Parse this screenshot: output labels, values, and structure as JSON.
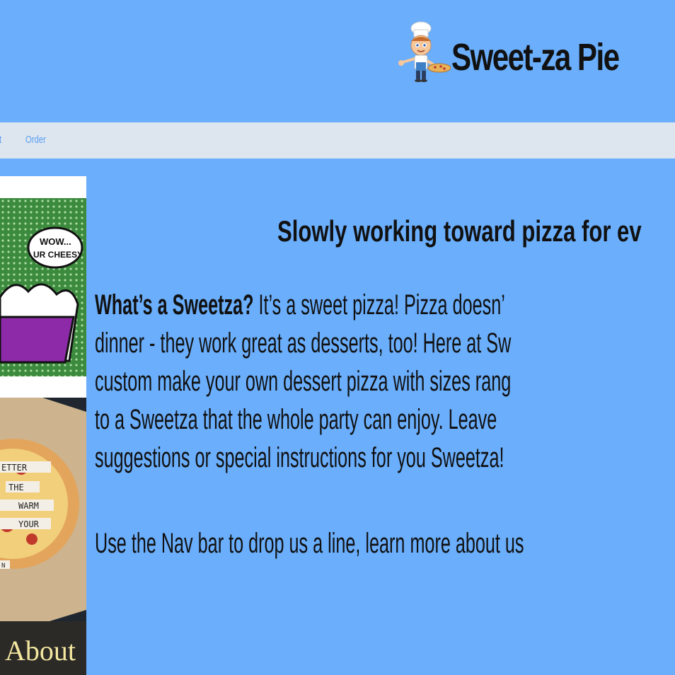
{
  "header": {
    "brand": "Sweet-za Pie",
    "logo_icon": "chef-boy-with-pizza-icon"
  },
  "nav": {
    "items": [
      {
        "label": "t"
      },
      {
        "label": "Order"
      }
    ]
  },
  "sidebar": {
    "image1": {
      "caption": "WOW... UR CHEESY"
    },
    "image2": {
      "words": [
        "ETTER",
        "THE",
        "WARM",
        "YOUR",
        "N"
      ]
    },
    "tile_label": "About"
  },
  "main": {
    "headline": "Slowly working toward pizza for ev",
    "intro_bold": "What’s a Sweetza?",
    "intro_line1": " It’s a sweet pizza! Pizza doesn’",
    "lines": [
      "dinner - they work great as desserts, too! Here at Sw",
      "custom make your own dessert pizza with sizes rang",
      "to a Sweetza that the whole party can enjoy. Leave",
      "suggestions or special instructions for you Sweetza!"
    ],
    "closing": "Use the Nav bar to drop us a line, learn more about us"
  },
  "colors": {
    "background": "#6aaefc",
    "navbar": "#dde6ef",
    "nav_text": "#5b9ef0",
    "tile": "#2b2a27",
    "tile_text": "#f4e7a0"
  }
}
